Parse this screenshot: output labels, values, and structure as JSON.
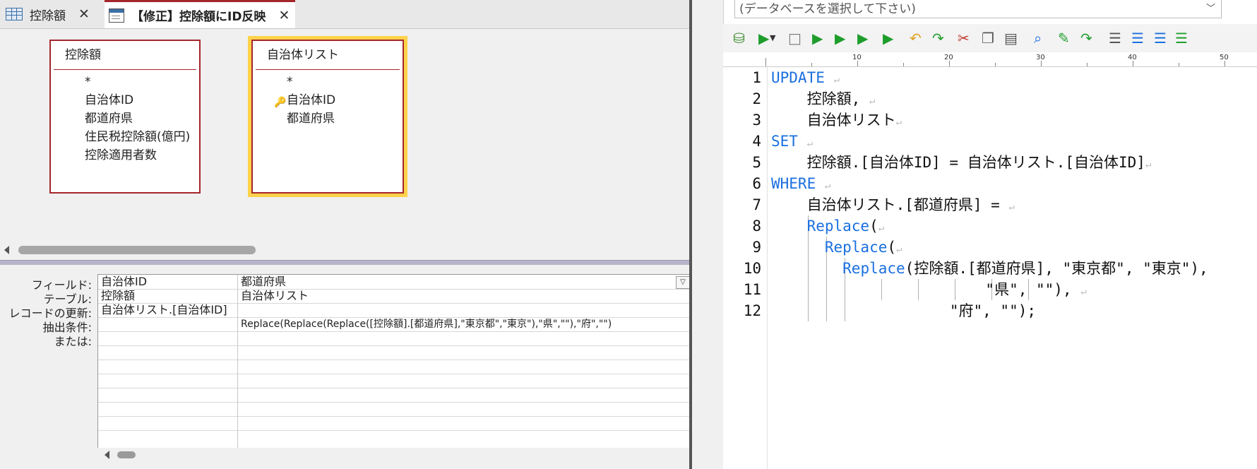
{
  "tabs": [
    {
      "label": "控除額",
      "icon": "table-icon"
    },
    {
      "label": "【修正】控除額にID反映",
      "icon": "query-icon"
    }
  ],
  "tables": [
    {
      "title": "控除額",
      "fields": [
        "*",
        "自治体ID",
        "都道府県",
        "住民税控除額(億円)",
        "控除適用者数"
      ]
    },
    {
      "title": "自治体リスト",
      "fields": [
        "*",
        "自治体ID",
        "都道府県"
      ]
    }
  ],
  "grid": {
    "row_labels": [
      "フィールド:",
      "テーブル:",
      "レコードの更新:",
      "抽出条件:",
      "または:"
    ],
    "columns": [
      {
        "field": "自治体ID",
        "table": "控除額",
        "update": "自治体リスト.[自治体ID]",
        "criteria": ""
      },
      {
        "field": "都道府県",
        "table": "自治体リスト",
        "update": "",
        "criteria": "Replace(Replace(Replace([控除額].[都道府県],\"東京都\",\"東京\"),\"県\",\"\"),\"府\",\"\")"
      }
    ]
  },
  "editor": {
    "db_placeholder": "(データベースを選択して下さい)",
    "ruler": [
      "10",
      "20",
      "30",
      "40",
      "50"
    ],
    "line_numbers": [
      "1",
      "2",
      "3",
      "4",
      "5",
      "6",
      "7",
      "8",
      "9",
      "10",
      "11",
      "12"
    ],
    "lines": [
      {
        "kw": "UPDATE",
        "text": ""
      },
      {
        "kw": "",
        "text": "    控除額,"
      },
      {
        "kw": "",
        "text": "    自治体リスト"
      },
      {
        "kw": "SET",
        "text": ""
      },
      {
        "kw": "",
        "text": "    控除額.[自治体ID] = 自治体リスト.[自治体ID]"
      },
      {
        "kw": "WHERE",
        "text": ""
      },
      {
        "kw": "",
        "text": "    自治体リスト.[都道府県] ="
      },
      {
        "kw": "Replace",
        "text": "(",
        "indent": "    "
      },
      {
        "kw": "Replace",
        "text": "(",
        "indent": "      "
      },
      {
        "kw": "Replace",
        "text": "(控除額.[都道府県], \"東京都\", \"東京\"),",
        "indent": "        "
      },
      {
        "kw": "",
        "text": "                        \"県\", \"\"),"
      },
      {
        "kw": "",
        "text": "                    \"府\", \"\");"
      }
    ]
  },
  "colors": {
    "access_accent": "#a4262c",
    "sql_keyword": "#1a6fe0",
    "selected_outline": "#ffd24a"
  }
}
